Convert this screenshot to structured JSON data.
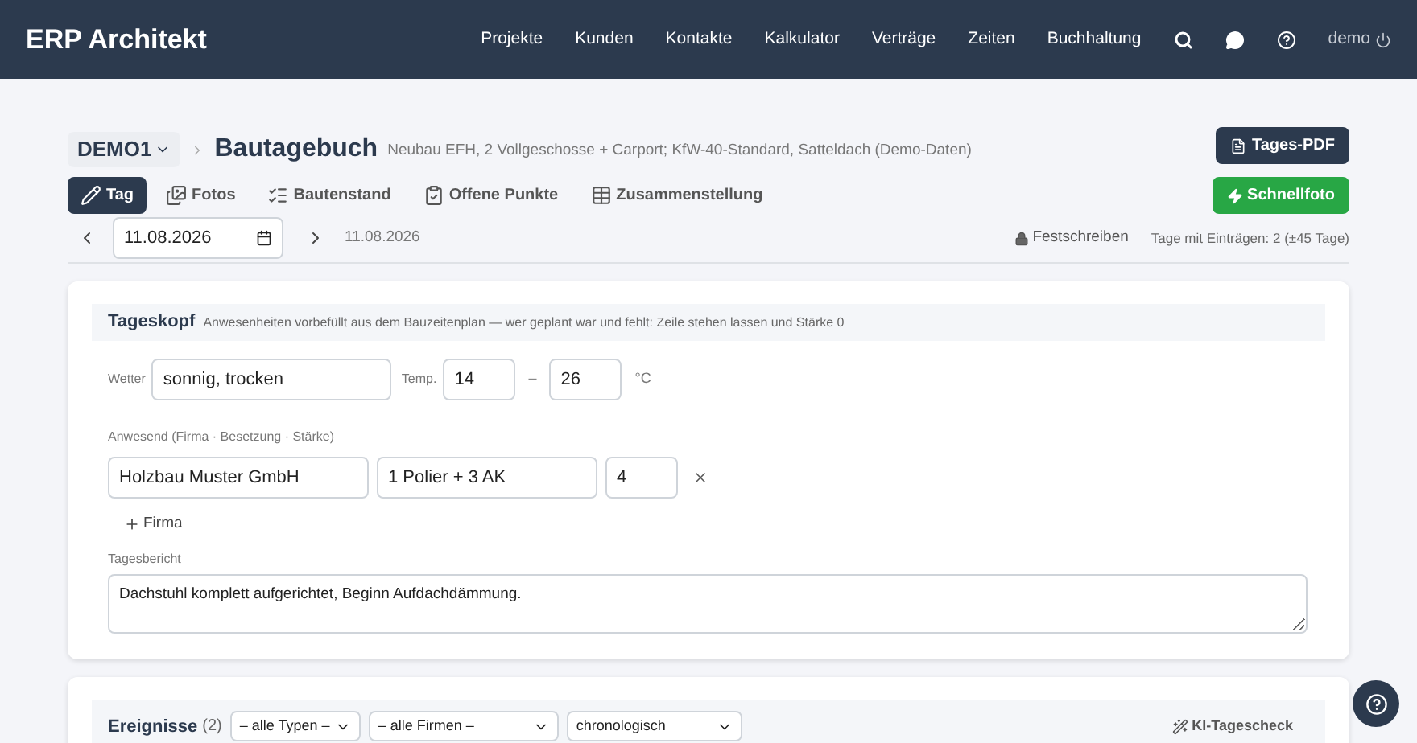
{
  "app_name": "ERP Architekt",
  "nav": [
    "Projekte",
    "Kunden",
    "Kontakte",
    "Kalkulator",
    "Verträge",
    "Zeiten",
    "Buchhaltung"
  ],
  "user": "demo",
  "project": "DEMO1",
  "title": "Bautagebuch",
  "subtitle": "Neubau EFH, 2 Vollgeschosse + Carport; KfW-40-Standard, Satteldach (Demo-Daten)",
  "pdf_button": "Tages-PDF",
  "quick_button": "Schnellfoto",
  "tabs": [
    {
      "label": "Tag",
      "kind": "pencil",
      "selected": true
    },
    {
      "label": "Fotos",
      "kind": "images",
      "selected": false
    },
    {
      "label": "Bautenstand",
      "kind": "checklist",
      "selected": false
    },
    {
      "label": "Offene Punkte",
      "kind": "clipboard",
      "selected": false
    },
    {
      "label": "Zusammenstellung",
      "kind": "table",
      "selected": false
    }
  ],
  "date_field": "11.08.2026",
  "date_label": "11.08.2026",
  "lock_button": "Festschreiben",
  "days_info": "Tage mit Einträgen: 2 (±45 Tage)",
  "day_head": {
    "title": "Tageskopf",
    "hint": "Anwesenheiten vorbefüllt aus dem Bauzeitenplan — wer geplant war und fehlt: Zeile stehen lassen und Stärke 0",
    "weather_label": "Wetter",
    "weather": "sonnig, trocken",
    "temp_label": "Temp.",
    "temp_min": "14",
    "dash": "–",
    "temp_max": "26",
    "unit": "°C",
    "attendance_label": "Anwesend (Firma · Besetzung · Stärke)",
    "attendance": [
      {
        "company": "Holzbau Muster GmbH",
        "staff": "1 Polier + 3 AK",
        "strength": "4"
      }
    ],
    "add_company": "Firma",
    "report_label": "Tagesbericht",
    "report": "Dachstuhl komplett aufgerichtet, Beginn Aufdachdämmung."
  },
  "events": {
    "title": "Ereignisse",
    "count": "(2)",
    "filters": [
      "– alle Typen –",
      "– alle Firmen –",
      "chronologisch"
    ],
    "ai_button": "KI-Tagescheck"
  }
}
